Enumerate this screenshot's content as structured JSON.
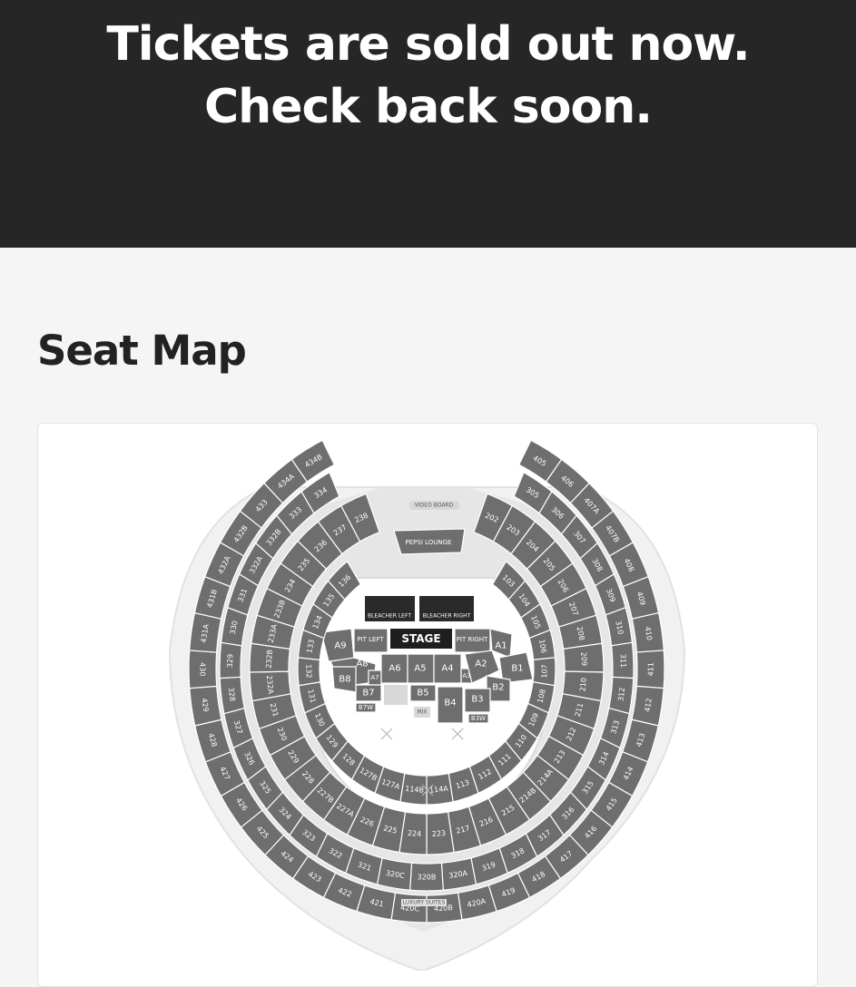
{
  "banner": {
    "line1": "Tickets are sold out now.",
    "line2": "Check back soon."
  },
  "seat_map": {
    "title": "Seat Map",
    "stage": "STAGE",
    "video_board": "VIDEO BOARD",
    "pepsi_lounge": "PEPSI LOUNGE",
    "luxury_suites": "LUXURY SUITES",
    "bleachers_left": "BLEACHER LEFT",
    "bleachers_right": "BLEACHER RIGHT",
    "mix": "MIX",
    "pit_left": "PIT LEFT",
    "pit_right": "PIT RIGHT",
    "floor": {
      "a1": "A1",
      "a2": "A2",
      "a3": "A3",
      "a4": "A4",
      "a5": "A5",
      "a6": "A6",
      "a7": "A7",
      "a8": "A8",
      "a9": "A9",
      "b1": "B1",
      "b2": "B2",
      "b3": "B3",
      "b3w": "B3W",
      "b4": "B4",
      "b5": "B5",
      "b7": "B7",
      "b7w": "B7W",
      "b8": "B8"
    },
    "ring_100": [
      "103",
      "104",
      "105",
      "106",
      "107",
      "108",
      "109",
      "110",
      "111",
      "112",
      "113",
      "114A",
      "114B",
      "127A",
      "127B",
      "128",
      "129",
      "130",
      "131",
      "132",
      "133",
      "134",
      "135",
      "136"
    ],
    "ring_200": [
      "202",
      "203",
      "204",
      "205",
      "206",
      "207",
      "208",
      "209",
      "210",
      "211",
      "212",
      "213",
      "214A",
      "214B",
      "215",
      "216",
      "217",
      "223",
      "224",
      "225",
      "226",
      "227A",
      "227B",
      "228",
      "229",
      "230",
      "231",
      "232A",
      "232B",
      "233A",
      "233B",
      "234",
      "235",
      "236",
      "237",
      "238"
    ],
    "ring_300": [
      "305",
      "306",
      "307",
      "308",
      "309",
      "310",
      "311",
      "312",
      "313",
      "314",
      "315",
      "316",
      "317",
      "318",
      "319",
      "320A",
      "320B",
      "320C",
      "321",
      "322",
      "323",
      "324",
      "325",
      "326",
      "327",
      "328",
      "329",
      "330",
      "331",
      "332A",
      "332B",
      "333",
      "334"
    ],
    "ring_400": [
      "405",
      "406",
      "407A",
      "407B",
      "408",
      "409",
      "410",
      "411",
      "412",
      "413",
      "414",
      "415",
      "416",
      "417",
      "418",
      "419",
      "420A",
      "420B",
      "420C",
      "421",
      "422",
      "423",
      "424",
      "425",
      "426",
      "427",
      "428",
      "429",
      "430",
      "431A",
      "431B",
      "432A",
      "432B",
      "433",
      "434A",
      "434B"
    ]
  }
}
